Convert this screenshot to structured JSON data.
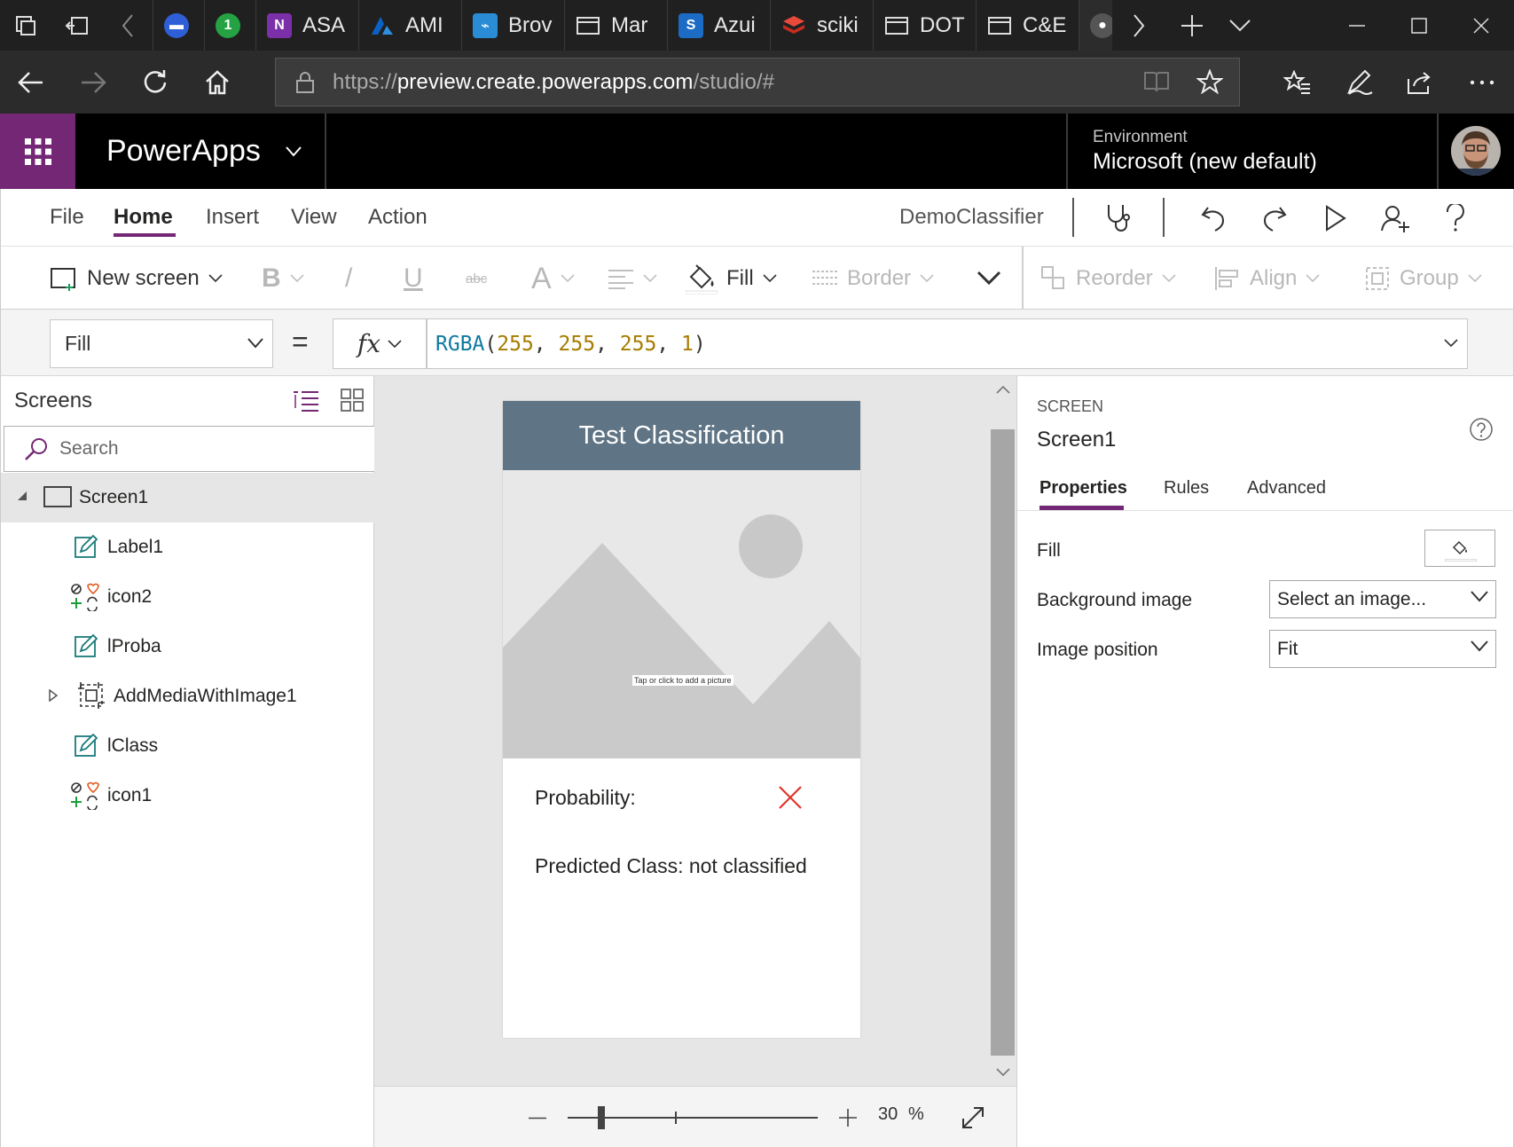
{
  "browser": {
    "tabs": [
      {
        "label": "",
        "icon": "messages-icon",
        "color": "#2f5fd6"
      },
      {
        "label": "",
        "icon": "whatsapp-icon",
        "color": "#25a244"
      },
      {
        "label": "ASA",
        "icon": "onenote-icon",
        "color": "#7b2fa8"
      },
      {
        "label": "AMI",
        "icon": "azure-ml-icon",
        "color": "#0b62c4"
      },
      {
        "label": "Brov",
        "icon": "bot-icon",
        "color": "#2b8cd6"
      },
      {
        "label": "Mar",
        "icon": "page-icon",
        "color": ""
      },
      {
        "label": "Azui",
        "icon": "sharepoint-icon",
        "color": "#1c6bc4"
      },
      {
        "label": "sciki",
        "icon": "stack-icon",
        "color": "#d93a2b"
      },
      {
        "label": "DOT",
        "icon": "page-icon",
        "color": ""
      },
      {
        "label": "C&E",
        "icon": "page-icon",
        "color": ""
      },
      {
        "label": "",
        "icon": "github-icon",
        "color": "#555555"
      }
    ],
    "url_prefix": "https://",
    "url_host": "preview.create.powerapps.com",
    "url_path": "/studio/#"
  },
  "header": {
    "product": "PowerApps",
    "env_label": "Environment",
    "env_name": "Microsoft (new default)"
  },
  "menu": {
    "tabs": [
      "File",
      "Home",
      "Insert",
      "View",
      "Action"
    ],
    "active": "Home",
    "app_name": "DemoClassifier"
  },
  "toolbar": {
    "new_screen": "New screen",
    "fill": "Fill",
    "border": "Border",
    "reorder": "Reorder",
    "align": "Align",
    "group": "Group"
  },
  "formula": {
    "property": "Fill",
    "fx": "fx",
    "fn": "RGBA",
    "args": [
      "255",
      "255",
      "255",
      "1"
    ]
  },
  "tree": {
    "title": "Screens",
    "search_placeholder": "Search",
    "items": [
      {
        "label": "Screen1",
        "icon": "screen-icon"
      },
      {
        "label": "Label1",
        "icon": "label-edit-icon"
      },
      {
        "label": "icon2",
        "icon": "icons-icon"
      },
      {
        "label": "lProba",
        "icon": "label-edit-icon"
      },
      {
        "label": "AddMediaWithImage1",
        "icon": "group-icon"
      },
      {
        "label": "lClass",
        "icon": "label-edit-icon"
      },
      {
        "label": "icon1",
        "icon": "icons-icon"
      }
    ]
  },
  "canvas": {
    "title": "Test Classification",
    "tap_text": "Tap or click to add a picture",
    "probability_label": "Probability:",
    "class_label": "Predicted Class: not classified",
    "header_color": "#5f7485",
    "zoom": "30",
    "zoom_unit": "%"
  },
  "props": {
    "kind": "SCREEN",
    "name": "Screen1",
    "tabs": [
      "Properties",
      "Rules",
      "Advanced"
    ],
    "fill_label": "Fill",
    "bg_image_label": "Background image",
    "bg_image_value": "Select an image...",
    "img_pos_label": "Image position",
    "img_pos_value": "Fit"
  },
  "colors": {
    "accent": "#742774",
    "formula_fn": "#0e7aa0",
    "formula_num": "#a67c00",
    "cancel_red": "#e0352b"
  }
}
